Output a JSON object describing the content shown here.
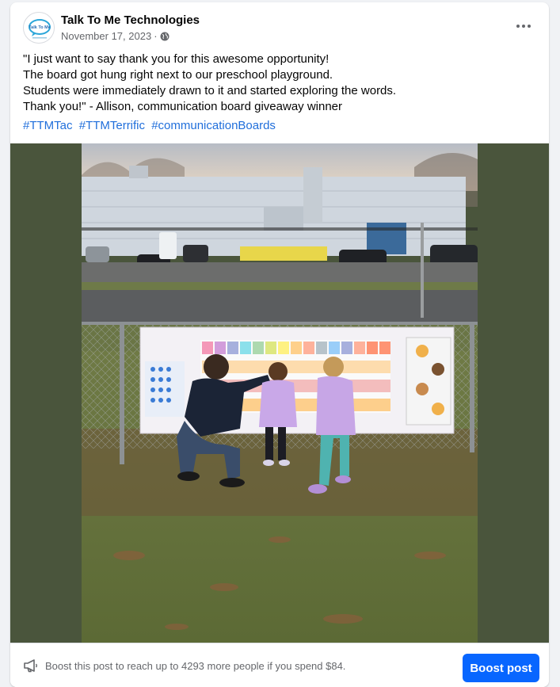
{
  "post": {
    "page_name": "Talk To Me Technologies",
    "logo_text": "Talk To Me",
    "date": "November 17, 2023",
    "separator": "·",
    "audience_icon": "globe-icon",
    "more_icon": "more-horizontal-icon",
    "text_lines": [
      "\"I just want to say thank you for this awesome opportunity!",
      "The board got hung right next to our preschool playground.",
      "Students were immediately drawn to it and started exploring the words.",
      "Thank you!\" - Allison, communication board giveaway winner"
    ],
    "hashtags": [
      "#TTMTac",
      "#TTMTerrific",
      "#communicationBoards"
    ]
  },
  "boost": {
    "icon": "megaphone-icon",
    "text": "Boost this post to reach up to 4293 more people if you spend $84.",
    "button_label": "Boost post"
  },
  "colors": {
    "link": "#216fdb",
    "primary_button": "#0866ff",
    "media_background": "#4a553c"
  }
}
